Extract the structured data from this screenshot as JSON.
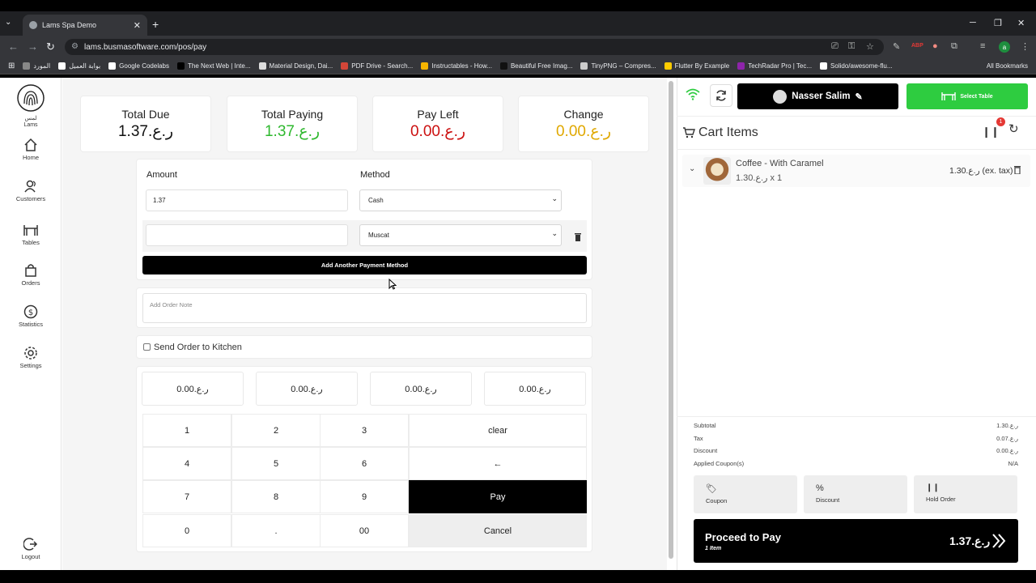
{
  "browser": {
    "tab_title": "Lams Spa Demo",
    "url": "lams.busmasoftware.com/pos/pay",
    "bookmarks": [
      {
        "label": "المورد",
        "color": "#888888"
      },
      {
        "label": "بوابة العميل",
        "color": "#ffffff"
      },
      {
        "label": "Google Codelabs",
        "color": "#ffffff"
      },
      {
        "label": "The Next Web | Inte...",
        "color": "#000000"
      },
      {
        "label": "Material Design, Dai...",
        "color": "#dddddd"
      },
      {
        "label": "PDF Drive - Search...",
        "color": "#d44638"
      },
      {
        "label": "Instructables - How...",
        "color": "#f7b500"
      },
      {
        "label": "Beautiful Free Imag...",
        "color": "#111111"
      },
      {
        "label": "TinyPNG – Compres...",
        "color": "#cccccc"
      },
      {
        "label": "Flutter By Example",
        "color": "#ffcc00"
      },
      {
        "label": "TechRadar Pro | Tec...",
        "color": "#8e24aa"
      },
      {
        "label": "Solido/awesome-flu...",
        "color": "#ffffff"
      }
    ],
    "all_bookmarks": "All Bookmarks"
  },
  "sidebar": {
    "logo_text": "لمس",
    "logo_sub": "Lams",
    "items": [
      {
        "label": "Home",
        "icon": "home-icon"
      },
      {
        "label": "Customers",
        "icon": "users-icon"
      },
      {
        "label": "Tables",
        "icon": "table-icon"
      },
      {
        "label": "Orders",
        "icon": "bag-icon"
      },
      {
        "label": "Statistics",
        "icon": "dollar-icon"
      },
      {
        "label": "Settings",
        "icon": "gear-icon"
      }
    ],
    "logout": "Logout"
  },
  "stats": {
    "total_due": {
      "label": "Total Due",
      "value": "1.37.ر.ع",
      "color": "#111111"
    },
    "total_paying": {
      "label": "Total Paying",
      "value": "1.37.ر.ع",
      "color": "#2eb82e"
    },
    "pay_left": {
      "label": "Pay Left",
      "value": "0.00.ر.ع",
      "color": "#cc1111"
    },
    "change": {
      "label": "Change",
      "value": "0.00.ر.ع",
      "color": "#e0a800"
    }
  },
  "payment": {
    "amount_label": "Amount",
    "method_label": "Method",
    "rows": [
      {
        "amount": "1.37",
        "method": "Cash"
      },
      {
        "amount": "",
        "method": "Muscat"
      }
    ],
    "add_button": "Add Another Payment Method",
    "note_placeholder": "Add Order Note",
    "kitchen_label": "Send Order to Kitchen"
  },
  "quick_amounts": [
    "0.00.ر.ع",
    "0.00.ر.ع",
    "0.00.ر.ع",
    "0.00.ر.ع"
  ],
  "keypad": {
    "rows": [
      [
        "1",
        "2",
        "3"
      ],
      [
        "4",
        "5",
        "6"
      ],
      [
        "7",
        "8",
        "9"
      ],
      [
        "0",
        ".",
        "00"
      ]
    ],
    "clear": "clear",
    "back": "←",
    "pay": "Pay",
    "cancel": "Cancel"
  },
  "right": {
    "user_name": "Nasser Salim",
    "select_table": "Select Table",
    "cart_title": "Cart Items",
    "held_count": "1",
    "cart_items": [
      {
        "name": "Coffee - With Caramel",
        "unit": "1.30.ر.ع x 1",
        "price": "1.30.ر.ع (ex. tax)"
      }
    ],
    "summary": [
      {
        "label": "Subtotal",
        "value": "1.30.ر.ع"
      },
      {
        "label": "Tax",
        "value": "0.07.ر.ع"
      },
      {
        "label": "Discount",
        "value": "0.00.ر.ع"
      },
      {
        "label": "Applied Coupon(s)",
        "value": "N/A"
      }
    ],
    "actions": [
      "Coupon",
      "Discount",
      "Hold Order"
    ],
    "proceed_label": "Proceed to Pay",
    "proceed_count": "1 Item",
    "proceed_total": "1.37.ر.ع"
  },
  "colors": {
    "accent_green": "#2ecc40",
    "danger": "#e53935"
  }
}
